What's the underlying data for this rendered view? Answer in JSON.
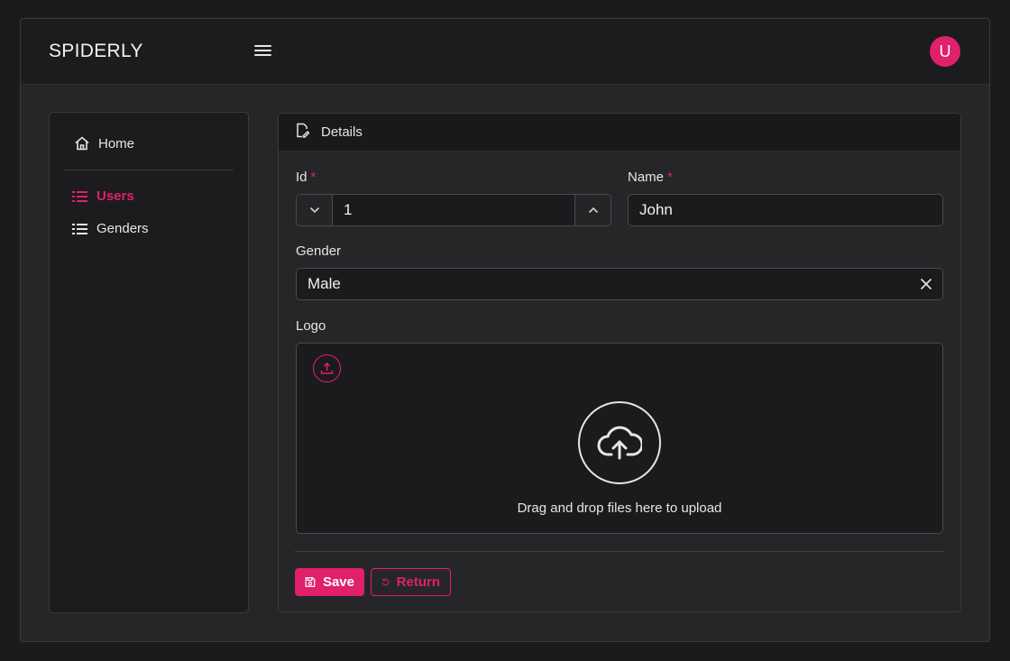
{
  "app": {
    "brand": "SPIDERLY",
    "avatar_initial": "U"
  },
  "sidebar": {
    "items": [
      {
        "label": "Home",
        "icon": "home-icon"
      },
      {
        "label": "Users",
        "icon": "list-icon",
        "active": true
      },
      {
        "label": "Genders",
        "icon": "list-icon"
      }
    ]
  },
  "panel": {
    "title": "Details",
    "fields": {
      "id": {
        "label": "Id",
        "required_mark": "*",
        "value": "1"
      },
      "name": {
        "label": "Name",
        "required_mark": "*",
        "value": "John"
      },
      "gender": {
        "label": "Gender",
        "value": "Male"
      },
      "logo": {
        "label": "Logo",
        "drop_text": "Drag and drop files here to upload"
      }
    },
    "actions": {
      "save_label": "Save",
      "return_label": "Return"
    }
  },
  "colors": {
    "accent": "#e0206b",
    "background": "#1b1b1d",
    "surface": "#262628"
  }
}
